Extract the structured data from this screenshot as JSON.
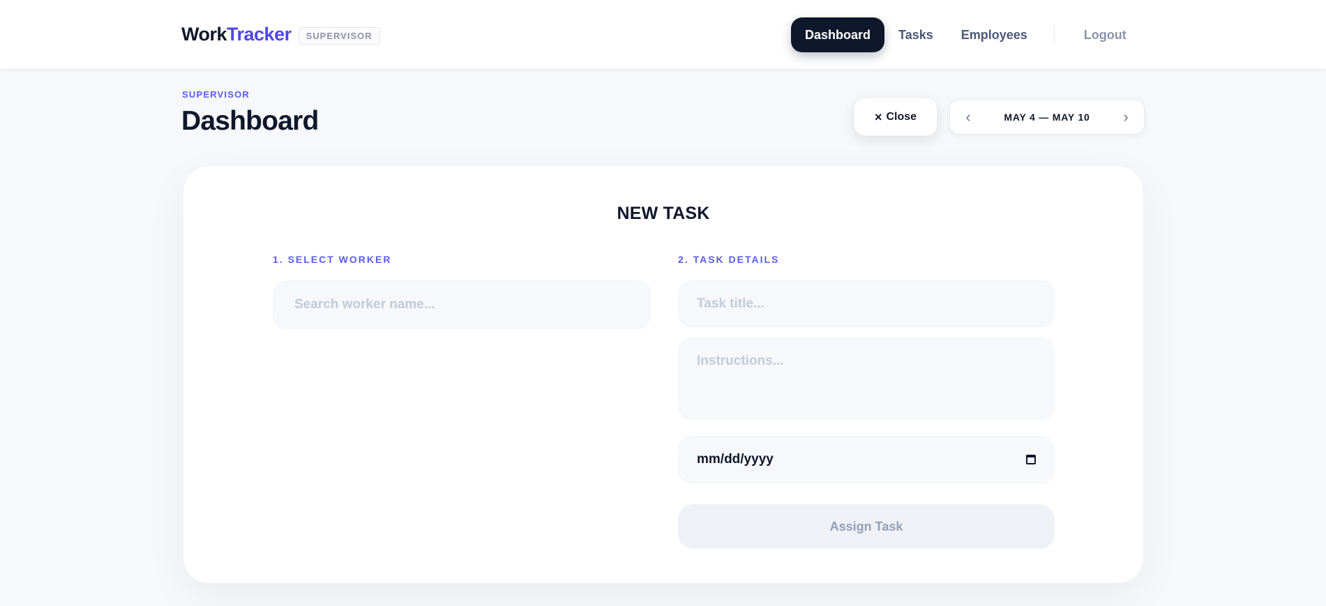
{
  "header": {
    "brand_work": "Work",
    "brand_tracker": "Tracker",
    "role_badge": "SUPERVISOR",
    "nav": [
      {
        "label": "Dashboard",
        "active": true
      },
      {
        "label": "Tasks",
        "active": false
      },
      {
        "label": "Employees",
        "active": false
      }
    ],
    "logout_label": "Logout"
  },
  "page": {
    "eyebrow": "SUPERVISOR",
    "title": "Dashboard",
    "close_label": "Close",
    "close_icon": "×",
    "date_range": {
      "label": "MAY 4 — MAY 10",
      "prev_icon": "‹",
      "next_icon": "›"
    }
  },
  "form": {
    "title": "NEW TASK",
    "section_worker": "1. SELECT WORKER",
    "section_details": "2. TASK DETAILS",
    "worker_search_placeholder": "Search worker name...",
    "task_title_placeholder": "Task title...",
    "instructions_placeholder": "Instructions...",
    "date_placeholder": "mm/dd/yyyy",
    "assign_label": "Assign Task"
  },
  "colors": {
    "accent": "#5b5bf0",
    "brand": "#4f46e5",
    "dark": "#0f172a"
  }
}
